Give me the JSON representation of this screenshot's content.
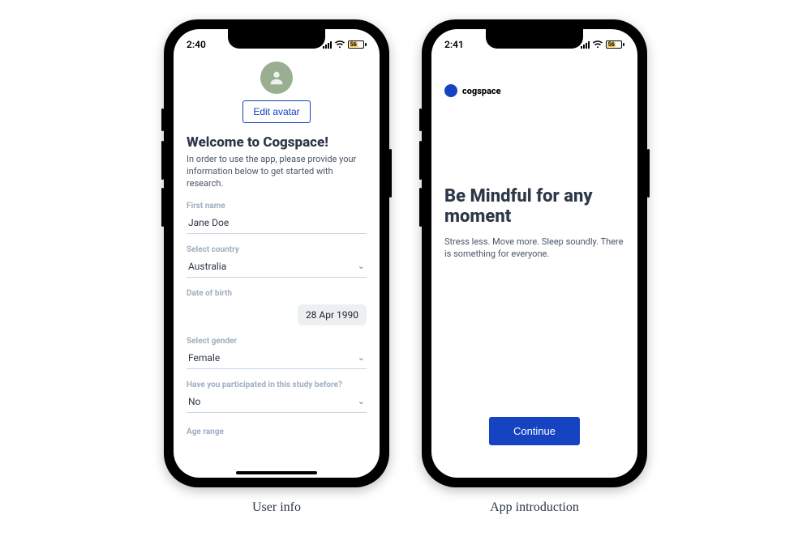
{
  "screen1": {
    "status_time": "2:40",
    "battery_text": "56",
    "edit_avatar_label": "Edit avatar",
    "welcome_title": "Welcome to Cogspace!",
    "welcome_sub": "In order to use the app, please provide your information below to get started with research.",
    "fields": {
      "first_name": {
        "label": "First name",
        "value": "Jane Doe"
      },
      "country": {
        "label": "Select country",
        "value": "Australia"
      },
      "dob": {
        "label": "Date of birth",
        "value": "28 Apr 1990"
      },
      "gender": {
        "label": "Select gender",
        "value": "Female"
      },
      "study": {
        "label": "Have you participated in this study before?",
        "value": "No"
      },
      "age_range": {
        "label": "Age range"
      }
    },
    "caption": "User info"
  },
  "screen2": {
    "status_time": "2:41",
    "battery_text": "56",
    "brand_name": "cogspace",
    "intro_title": "Be Mindful for any moment",
    "intro_sub": "Stress less. Move more. Sleep soundly. There is something for everyone.",
    "continue_label": "Continue",
    "caption": "App introduction"
  }
}
